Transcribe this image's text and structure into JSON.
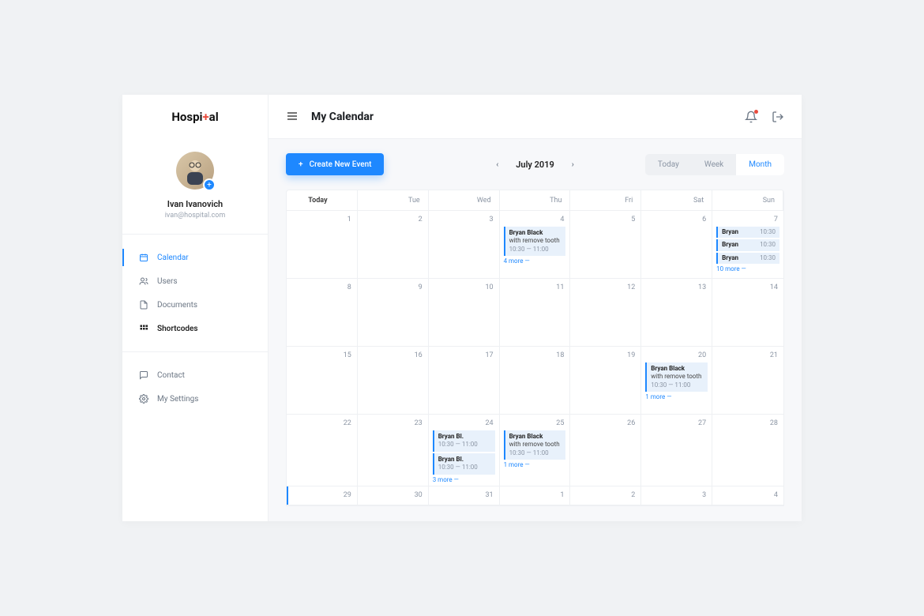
{
  "brand": {
    "name": "Hospi",
    "name2": "al"
  },
  "profile": {
    "name": "Ivan Ivanovich",
    "email": "ivan@hospital.com"
  },
  "nav": {
    "group1": [
      {
        "label": "Calendar"
      },
      {
        "label": "Users"
      },
      {
        "label": "Documents"
      },
      {
        "label": "Shortcodes"
      }
    ],
    "group2": [
      {
        "label": "Contact"
      },
      {
        "label": "My Settings"
      }
    ]
  },
  "page": {
    "title": "My Calendar"
  },
  "controls": {
    "create_label": "Create New Event",
    "period": "July 2019",
    "views": {
      "today": "Today",
      "week": "Week",
      "month": "Month"
    }
  },
  "cal_head": {
    "today": "Today",
    "tue": "Tue",
    "wed": "Wed",
    "thu": "Thu",
    "fri": "Fri",
    "sat": "Sat",
    "sun": "Sun"
  },
  "days": {
    "r1": [
      "1",
      "2",
      "3",
      "4",
      "5",
      "6",
      "7"
    ],
    "r2": [
      "8",
      "9",
      "10",
      "11",
      "12",
      "13",
      "14"
    ],
    "r3": [
      "15",
      "16",
      "17",
      "18",
      "19",
      "20",
      "21"
    ],
    "r4": [
      "22",
      "23",
      "24",
      "25",
      "26",
      "27",
      "28"
    ],
    "r5": [
      "29",
      "30",
      "31",
      "1",
      "2",
      "3",
      "4"
    ]
  },
  "events": {
    "d4": {
      "name": "Bryan Black",
      "desc": "with remove tooth",
      "time": "10:30 — 11:00",
      "more": "4 more —"
    },
    "d7": {
      "e1name": "Bryan",
      "e1time": "10:30",
      "e2name": "Bryan",
      "e2time": "10:30",
      "e3name": "Bryan",
      "e3time": "10:30",
      "more": "10 more —"
    },
    "d20": {
      "name": "Bryan Black",
      "desc": "with remove tooth",
      "time": "10:30 — 11:00",
      "more": "1 more —"
    },
    "d24": {
      "e1name": "Bryan Bl.",
      "e1time": "10:30 — 11:00",
      "e2name": "Bryan Bl.",
      "e2time": "10:30 — 11:00",
      "more": "3 more —"
    },
    "d25": {
      "name": "Bryan Black",
      "desc": "with remove tooth",
      "time": "10:30 — 11:00",
      "more": "1 more —"
    }
  }
}
